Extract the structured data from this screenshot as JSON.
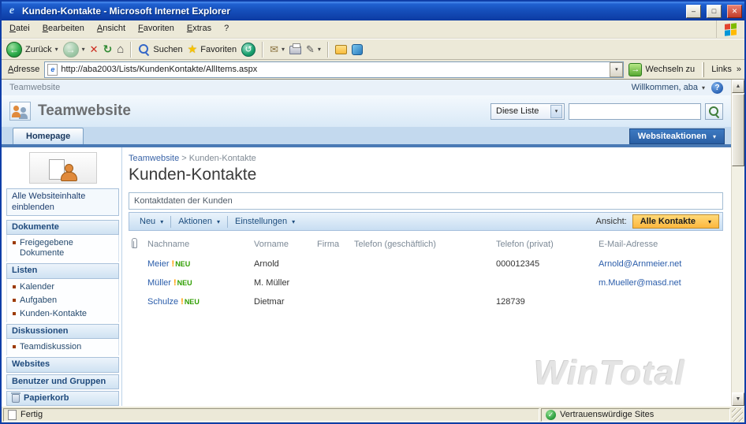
{
  "window": {
    "title": "Kunden-Kontakte - Microsoft Internet Explorer"
  },
  "glyphs": {
    "ie_logo": "e",
    "minimize": "–",
    "maximize": "□",
    "close": "✕",
    "back_arrow": "←",
    "forward_arrow": "→",
    "stop": "✕",
    "refresh": "↻",
    "home": "⌂",
    "star": "★",
    "media": "↺",
    "mail": "✉",
    "edit": "✎",
    "caret": "▾",
    "go_arrow": "→",
    "help": "?",
    "check": "✓",
    "scroll_up": "▲",
    "scroll_down": "▼"
  },
  "menubar": {
    "items": [
      "Datei",
      "Bearbeiten",
      "Ansicht",
      "Favoriten",
      "Extras",
      "?"
    ]
  },
  "browser_toolbar": {
    "back_label": "Zurück",
    "search_label": "Suchen",
    "favorites_label": "Favoriten"
  },
  "addressbar": {
    "label": "Adresse",
    "url": "http://aba2003/Lists/KundenKontakte/AllItems.aspx",
    "go_label": "Wechseln zu",
    "links_label": "Links",
    "links_chevron": "»"
  },
  "portal": {
    "toplink": {
      "site": "Teamwebsite",
      "welcome": "Willkommen, aba",
      "help": "?"
    },
    "header": {
      "title": "Teamwebsite",
      "scope": "Diese Liste",
      "search_value": ""
    },
    "tabs": {
      "homepage": "Homepage",
      "site_actions": "Websiteaktionen"
    },
    "sidebar": {
      "view_all": "Alle Websiteinhalte einblenden",
      "sections": [
        {
          "header": "Dokumente",
          "items": [
            "Freigegebene Dokumente"
          ]
        },
        {
          "header": "Listen",
          "items": [
            "Kalender",
            "Aufgaben",
            "Kunden-Kontakte"
          ]
        },
        {
          "header": "Diskussionen",
          "items": [
            "Teamdiskussion"
          ]
        },
        {
          "header": "Websites",
          "items": []
        },
        {
          "header": "Benutzer und Gruppen",
          "items": []
        },
        {
          "header": "Papierkorb",
          "items": []
        }
      ]
    },
    "content": {
      "breadcrumb": {
        "parent": "Teamwebsite",
        "sep": ">",
        "current": "Kunden-Kontakte"
      },
      "title": "Kunden-Kontakte",
      "description": "Kontaktdaten der Kunden",
      "toolbar": {
        "neu": "Neu",
        "aktionen": "Aktionen",
        "einstellungen": "Einstellungen",
        "ansicht_label": "Ansicht:",
        "view": "Alle Kontakte"
      },
      "table": {
        "columns": [
          "Nachname",
          "Vorname",
          "Firma",
          "Telefon (geschäftlich)",
          "Telefon (privat)",
          "E-Mail-Adresse"
        ],
        "new_marker": {
          "bang": "!",
          "label": "NEU"
        },
        "rows": [
          {
            "nachname": "Meier",
            "vorname": "Arnold",
            "firma": "",
            "tel_business": "",
            "tel_private": "000012345",
            "email": "Arnold@Arnmeier.net"
          },
          {
            "nachname": "Müller",
            "vorname": "M. Müller",
            "firma": "",
            "tel_business": "",
            "tel_private": "",
            "email": "m.Mueller@masd.net"
          },
          {
            "nachname": "Schulze",
            "vorname": "Dietmar",
            "firma": "",
            "tel_business": "",
            "tel_private": "128739",
            "email": ""
          }
        ]
      },
      "watermark": "WinTotal"
    }
  },
  "statusbar": {
    "status": "Fertig",
    "zone": "Vertrauenswürdige Sites"
  },
  "colors": {
    "titlebar_blue": "#1450c8",
    "xp_chrome": "#ece9d8",
    "sp_band_blue": "#4a7ab5",
    "site_actions_blue": "#2f6cb4",
    "view_highlight_orange": "#fcbf4a",
    "link_blue": "#2a5caa",
    "new_green": "#2f9e00",
    "new_bang_orange": "#ff9c00",
    "bullet_maroon": "#9c3a00"
  }
}
